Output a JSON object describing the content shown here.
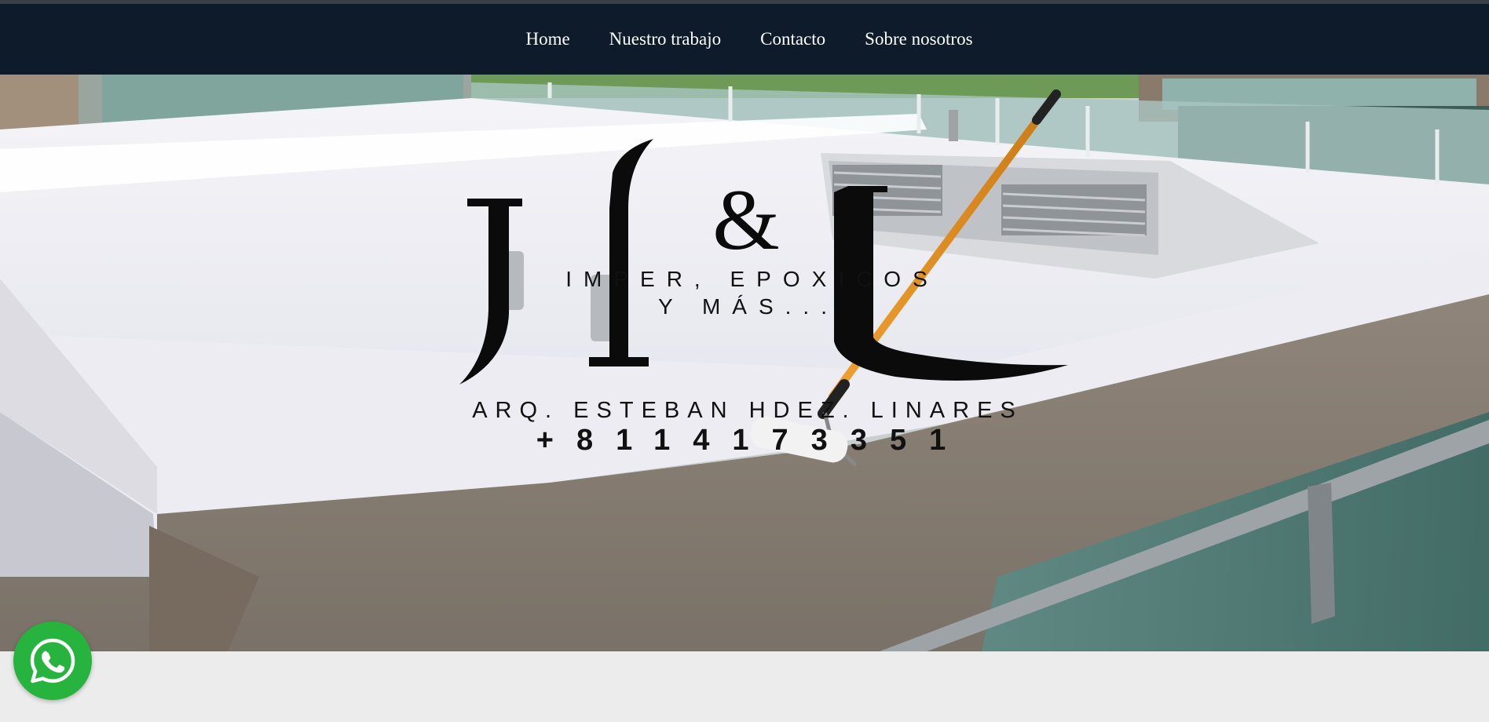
{
  "nav": {
    "items": [
      {
        "label": "Home"
      },
      {
        "label": "Nuestro trabajo"
      },
      {
        "label": "Contacto"
      },
      {
        "label": "Sobre nosotros"
      }
    ]
  },
  "hero": {
    "logo": {
      "letters": "H&L",
      "tagline_1": "IMPER, EPOXICOS",
      "tagline_2": "Y MÁS...",
      "owner": "ARQ. ESTEBAN HDEZ. LINARES",
      "phone": "+8114173351"
    }
  },
  "whatsapp": {
    "icon": "whatsapp-icon",
    "color": "#27b43e"
  },
  "colors": {
    "navbar": "#0d1b2b",
    "page_bg": "#ececec"
  }
}
